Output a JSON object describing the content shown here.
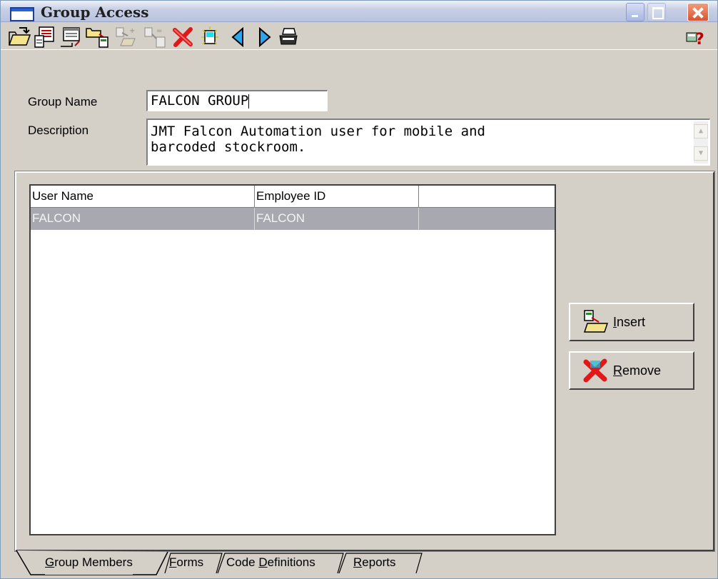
{
  "window": {
    "title": "Group Access"
  },
  "toolbar": {
    "buttons": [
      {
        "name": "open-icon"
      },
      {
        "name": "form-icon"
      },
      {
        "name": "export-icon"
      },
      {
        "name": "folder-copy-icon"
      },
      {
        "name": "add-record-icon"
      },
      {
        "name": "batch-insert-icon"
      },
      {
        "name": "delete-icon"
      },
      {
        "name": "new-record-icon"
      },
      {
        "name": "previous-icon"
      },
      {
        "name": "next-icon"
      },
      {
        "name": "print-icon"
      },
      {
        "name": "help-icon"
      }
    ]
  },
  "form": {
    "group_name_label": "Group Name",
    "group_name_value": "FALCON GROUP",
    "description_label": "Description",
    "description_value": "JMT Falcon Automation user for mobile and\nbarcoded stockroom."
  },
  "members_grid": {
    "columns": [
      "User Name",
      "Employee ID",
      ""
    ],
    "rows": [
      {
        "user_name": "FALCON",
        "employee_id": "FALCON",
        "extra": ""
      }
    ]
  },
  "actions": {
    "insert_label": "Insert",
    "insert_mnemonic": "I",
    "insert_rest": "nsert",
    "remove_label": "Remove",
    "remove_mnemonic": "R",
    "remove_rest": "emove"
  },
  "tabs": [
    {
      "label": "Group Members",
      "mnemonic": "G",
      "rest": "roup Members",
      "active": true
    },
    {
      "label": "Forms",
      "mnemonic": "F",
      "rest": "orms",
      "active": false
    },
    {
      "label": "Code Definitions",
      "pre": "Code ",
      "mnemonic": "D",
      "rest": "efinitions",
      "active": false
    },
    {
      "label": "Reports",
      "mnemonic": "R",
      "rest": "eports",
      "active": false
    }
  ],
  "colors": {
    "window_bg": "#d4d0c8",
    "selected_row": "#a8a8b0",
    "title_gradient_top": "#eef1f8"
  }
}
